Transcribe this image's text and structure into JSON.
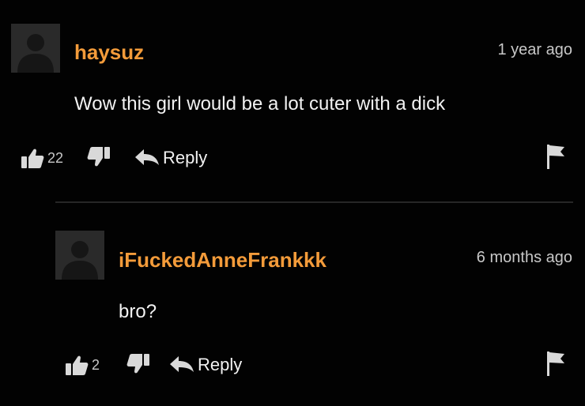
{
  "comments": [
    {
      "username": "haysuz",
      "timestamp": "1 year ago",
      "text": "Wow this girl would be a lot cuter with a dick",
      "likes": "22",
      "reply_label": "Reply"
    },
    {
      "username": "iFuckedAnneFrankkk",
      "timestamp": "6 months ago",
      "text": "bro?",
      "likes": "2",
      "reply_label": "Reply"
    }
  ],
  "icons": {
    "avatar": "default-avatar-icon",
    "like": "thumbs-up-icon",
    "dislike": "thumbs-down-icon",
    "reply": "reply-arrow-icon",
    "flag": "flag-icon"
  },
  "colors": {
    "background": "#020202",
    "username": "#f39b3a",
    "text": "#f2f2f2",
    "muted": "#c8c8c8",
    "icon": "#d9d9d9",
    "avatar_bg": "#2a2a2a",
    "divider": "#262626"
  }
}
